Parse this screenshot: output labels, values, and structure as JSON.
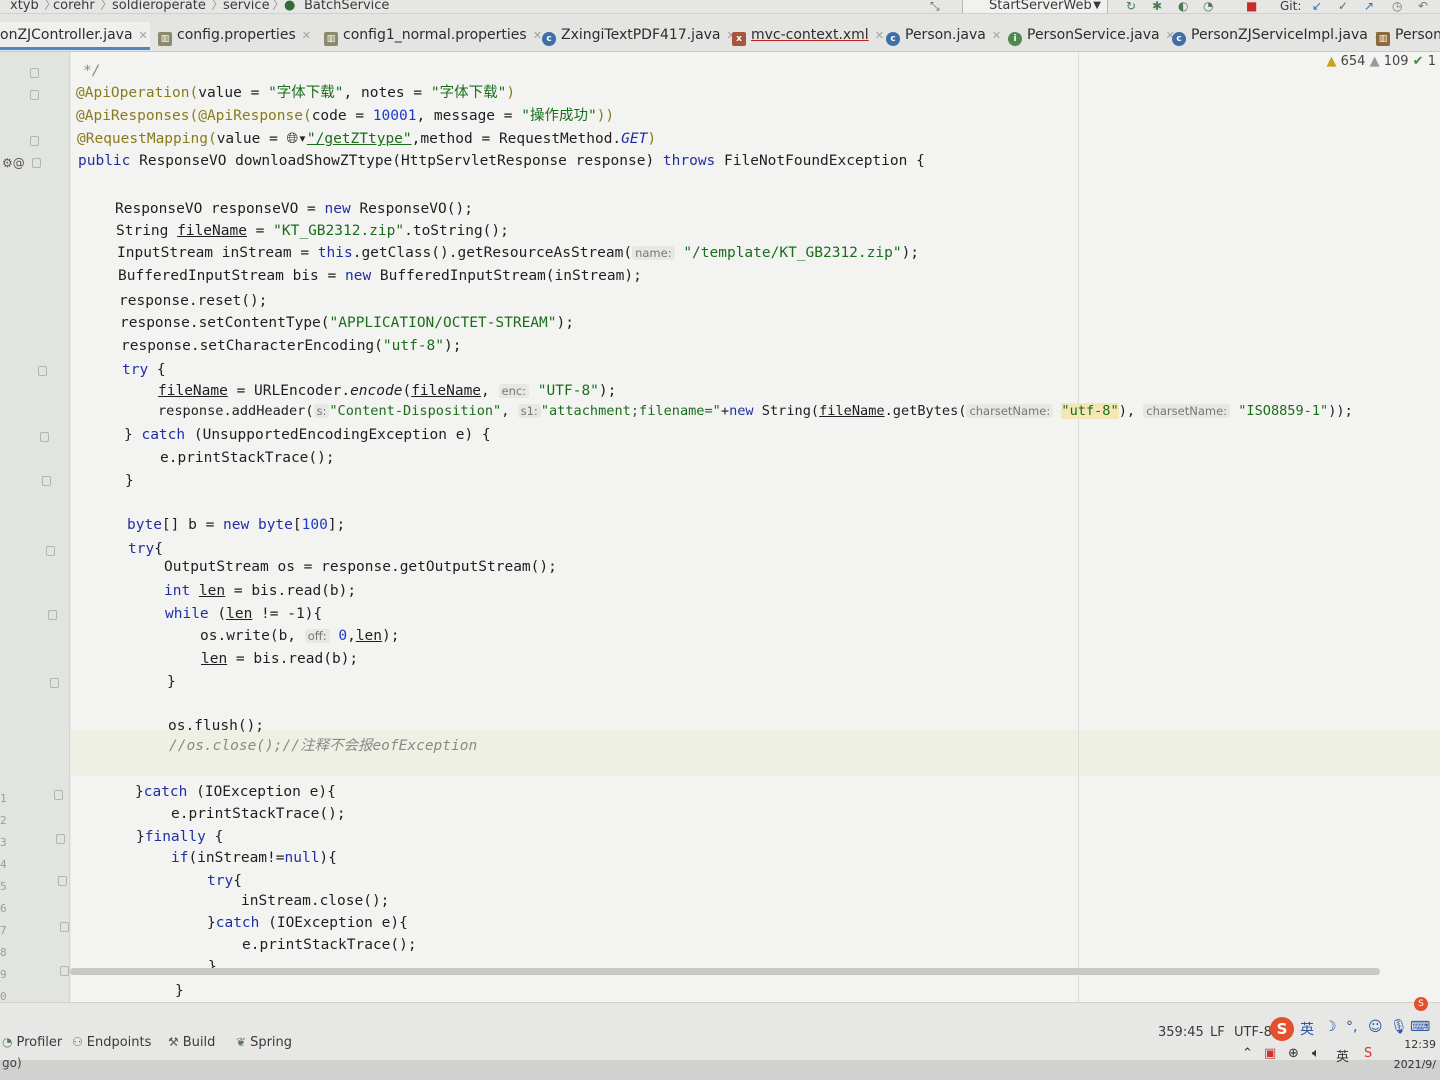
{
  "breadcrumb": [
    "xtyb",
    "corehr",
    "soldieroperate",
    "service",
    "BatchService"
  ],
  "run_config": "StartServerWeb",
  "git_label": "Git:",
  "tabs": [
    {
      "label": "onZJController.java",
      "active": true,
      "icon": "controller-class-icon"
    },
    {
      "label": "config.properties",
      "icon": "properties-file-icon"
    },
    {
      "label": "config1_normal.properties",
      "icon": "properties-file-icon"
    },
    {
      "label": "ZxingiTextPDF417.java",
      "icon": "java-class-icon"
    },
    {
      "label": "mvc-context.xml",
      "icon": "xml-file-icon"
    },
    {
      "label": "Person.java",
      "icon": "java-class-icon"
    },
    {
      "label": "PersonService.java",
      "icon": "java-interface-icon"
    },
    {
      "label": "PersonZJServiceImpl.java",
      "icon": "java-class-icon"
    },
    {
      "label": "PersonD",
      "icon": "java-class-icon"
    }
  ],
  "inspections": {
    "warnings": "654",
    "weak_warnings": "109",
    "ok": "1"
  },
  "code": {
    "comment_end": "*/",
    "api_operation": {
      "anno": "@ApiOperation(",
      "value_kw": "value = ",
      "value": "\"字体下载\"",
      "notes_kw": ", notes = ",
      "notes": "\"字体下载\"",
      "close": ")"
    },
    "api_responses": {
      "anno": "@ApiResponses(@ApiResponse(",
      "code_kw": "code = ",
      "code": "10001",
      "msg_kw": ", message = ",
      "msg": "\"操作成功\"",
      "close": "))"
    },
    "request_mapping": {
      "anno": "@RequestMapping(",
      "value_kw": "value = ",
      "url": "\"/getZTtype\"",
      "method_kw": ",method = RequestMethod.",
      "method": "GET",
      "close": ")"
    },
    "signature": {
      "kw": "public",
      "rest": " ResponseVO downloadShowZTtype(HttpServletResponse response) ",
      "throws": "throws",
      "exc": " FileNotFoundException {"
    },
    "l1": {
      "a": "ResponseVO responseVO = ",
      "kw": "new",
      "b": " ResponseVO();"
    },
    "l2": {
      "a": "String ",
      "var": "fileName",
      "b": " = ",
      "str": "\"KT_GB2312.zip\"",
      "c": ".toString();"
    },
    "l3": {
      "a": "InputStream inStream = ",
      "kw": "this",
      "b": ".getClass().getResourceAsStream(",
      "hint": "name:",
      "str": "\"/template/KT_GB2312.zip\"",
      "c": ");"
    },
    "l4": {
      "a": "BufferedInputStream bis = ",
      "kw": "new",
      "b": " BufferedInputStream(inStream);"
    },
    "l5": "response.reset();",
    "l6": {
      "a": "response.setContentType(",
      "str": "\"APPLICATION/OCTET-STREAM\"",
      "b": ");"
    },
    "l7": {
      "a": "response.setCharacterEncoding(",
      "str": "\"utf-8\"",
      "b": ");"
    },
    "l8": {
      "kw": "try",
      "b": " {"
    },
    "l9": {
      "var": "fileName",
      "a": " = URLEncoder.",
      "it": "encode",
      "b": "(",
      "var2": "fileName",
      "c": ", ",
      "hint": "enc:",
      "str": "\"UTF-8\"",
      "d": ");"
    },
    "l10": {
      "a": "response.addHeader(",
      "hint1": "s:",
      "str1": "\"Content-Disposition\"",
      "b": ", ",
      "hint2": "s1:",
      "str2": "\"attachment;filename=\"",
      "c": "+",
      "kw": "new",
      "d": " String(",
      "var": "fileName",
      "e": ".getBytes(",
      "hint3": "charsetName:",
      "str3": "\"utf-8\"",
      "f": "), ",
      "hint4": "charsetName:",
      "str4": "\"ISO8859-1\"",
      "g": "));"
    },
    "l11": {
      "a": "} ",
      "kw": "catch",
      "b": " (UnsupportedEncodingException e) {"
    },
    "l12": "e.printStackTrace();",
    "l13": "}",
    "l14": {
      "kw": "byte",
      "a": "[] b = ",
      "kw2": "new",
      "kw3": " byte",
      "b": "[",
      "num": "100",
      "c": "];"
    },
    "l15": {
      "kw": "try",
      "b": "{"
    },
    "l16": "OutputStream os = response.getOutputStream();",
    "l17": {
      "kw": "int",
      "a": " ",
      "var": "len",
      "b": " = bis.read(b);"
    },
    "l18": {
      "kw": "while",
      "a": " (",
      "var": "len",
      "b": " != -1){"
    },
    "l19": {
      "a": "os.write(b, ",
      "hint": "off:",
      "num": "0",
      "b": ",",
      "var": "len",
      "c": ");"
    },
    "l20": {
      "var": "len",
      "a": " = bis.read(b);"
    },
    "l21": "}",
    "l22": "os.flush();",
    "l23": "//os.close();//注释不会报eofException",
    "l24": {
      "a": "}",
      "kw": "catch",
      "b": " (IOException e){"
    },
    "l25": "e.printStackTrace();",
    "l26": {
      "a": "}",
      "kw": "finally",
      "b": " {"
    },
    "l27": {
      "kw": "if",
      "a": "(inStream!=",
      "kw2": "null",
      "b": "){"
    },
    "l28": {
      "kw": "try",
      "b": "{"
    },
    "l29": "inStream.close();",
    "l30": {
      "a": "}",
      "kw": "catch",
      "b": " (IOException e){"
    },
    "l31": "e.printStackTrace();",
    "l32": "}",
    "l33": "}"
  },
  "gutter_numbers": [
    "1",
    "2",
    "3",
    "4",
    "5",
    "6",
    "7",
    "8",
    "9",
    "0"
  ],
  "bottom_tools": [
    {
      "label": "Profiler",
      "icon": "profiler-icon"
    },
    {
      "label": "Endpoints",
      "icon": "endpoints-icon"
    },
    {
      "label": "Build",
      "icon": "hammer-icon"
    },
    {
      "label": "Spring",
      "icon": "spring-leaf-icon"
    }
  ],
  "status_bar": {
    "position": "359:45",
    "line_sep": "LF",
    "encoding": "UTF-8"
  },
  "ime": {
    "logo": "S",
    "lang": "英"
  },
  "taskbar": {
    "lang": "英",
    "time": "12:39",
    "date": "2021/9/",
    "left_text": "go)"
  }
}
